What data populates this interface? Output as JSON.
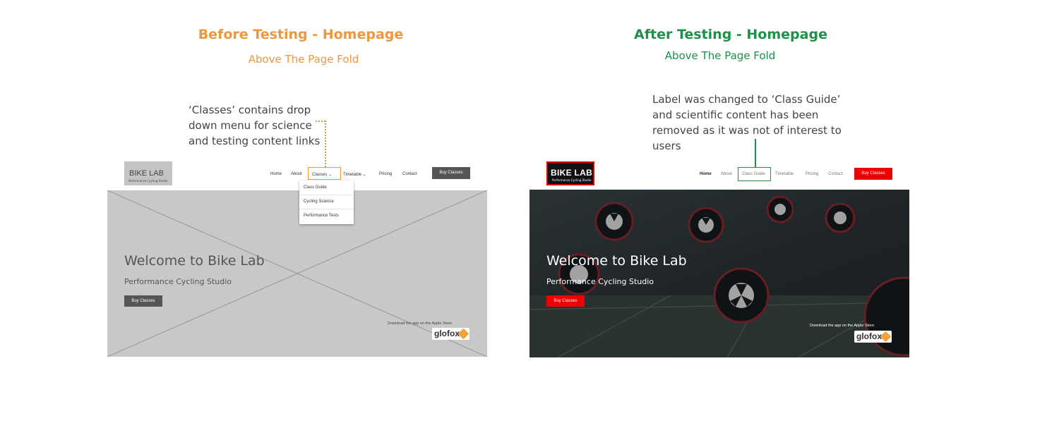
{
  "before": {
    "heading": "Before Testing - Homepage",
    "subheading": "Above The Page Fold",
    "annotation": [
      "‘Classes’ contains drop",
      "down menu for science",
      "and testing content links"
    ],
    "logo": {
      "title": "BIKE LAB",
      "tagline": "Performance Cycling Studio"
    },
    "nav": [
      "Home",
      "About",
      "Classes",
      "Timetable",
      "Pricing",
      "Contact"
    ],
    "nav_button": "Buy Classes",
    "dropdown": [
      "Class Guide",
      "Cycling Science",
      "Performance Tests"
    ],
    "hero": {
      "title": "Welcome to Bike Lab",
      "subtitle": "Performance Cycling Studio",
      "button": "Buy Classes"
    },
    "app_text": "Download the app on the Apple Store",
    "app_logo": "glofox"
  },
  "after": {
    "heading": "After Testing - Homepage",
    "subheading": "Above The Page Fold",
    "annotation": [
      "Label was changed to ‘Class Guide’",
      "and scientific content has been",
      "removed as it was not of interest to",
      "users"
    ],
    "logo": {
      "title": "BIKE LAB",
      "tagline": "Performance Cycling Studio"
    },
    "nav": [
      "Home",
      "About",
      "Class Guide",
      "Timetable",
      "Pricing",
      "Contact"
    ],
    "nav_button": "Buy Classes",
    "hero": {
      "title": "Welcome to Bike Lab",
      "subtitle": "Performance Cycling Studio",
      "button": "Buy Classes"
    },
    "app_text": "Download the app on the Apple Store",
    "app_logo": "glofox"
  },
  "colors": {
    "before_accent": "#f0963c",
    "after_accent": "#1e9148",
    "brand_red": "#ee0000",
    "wireframe_gray": "#c8c8c8",
    "dark_button": "#555555"
  }
}
